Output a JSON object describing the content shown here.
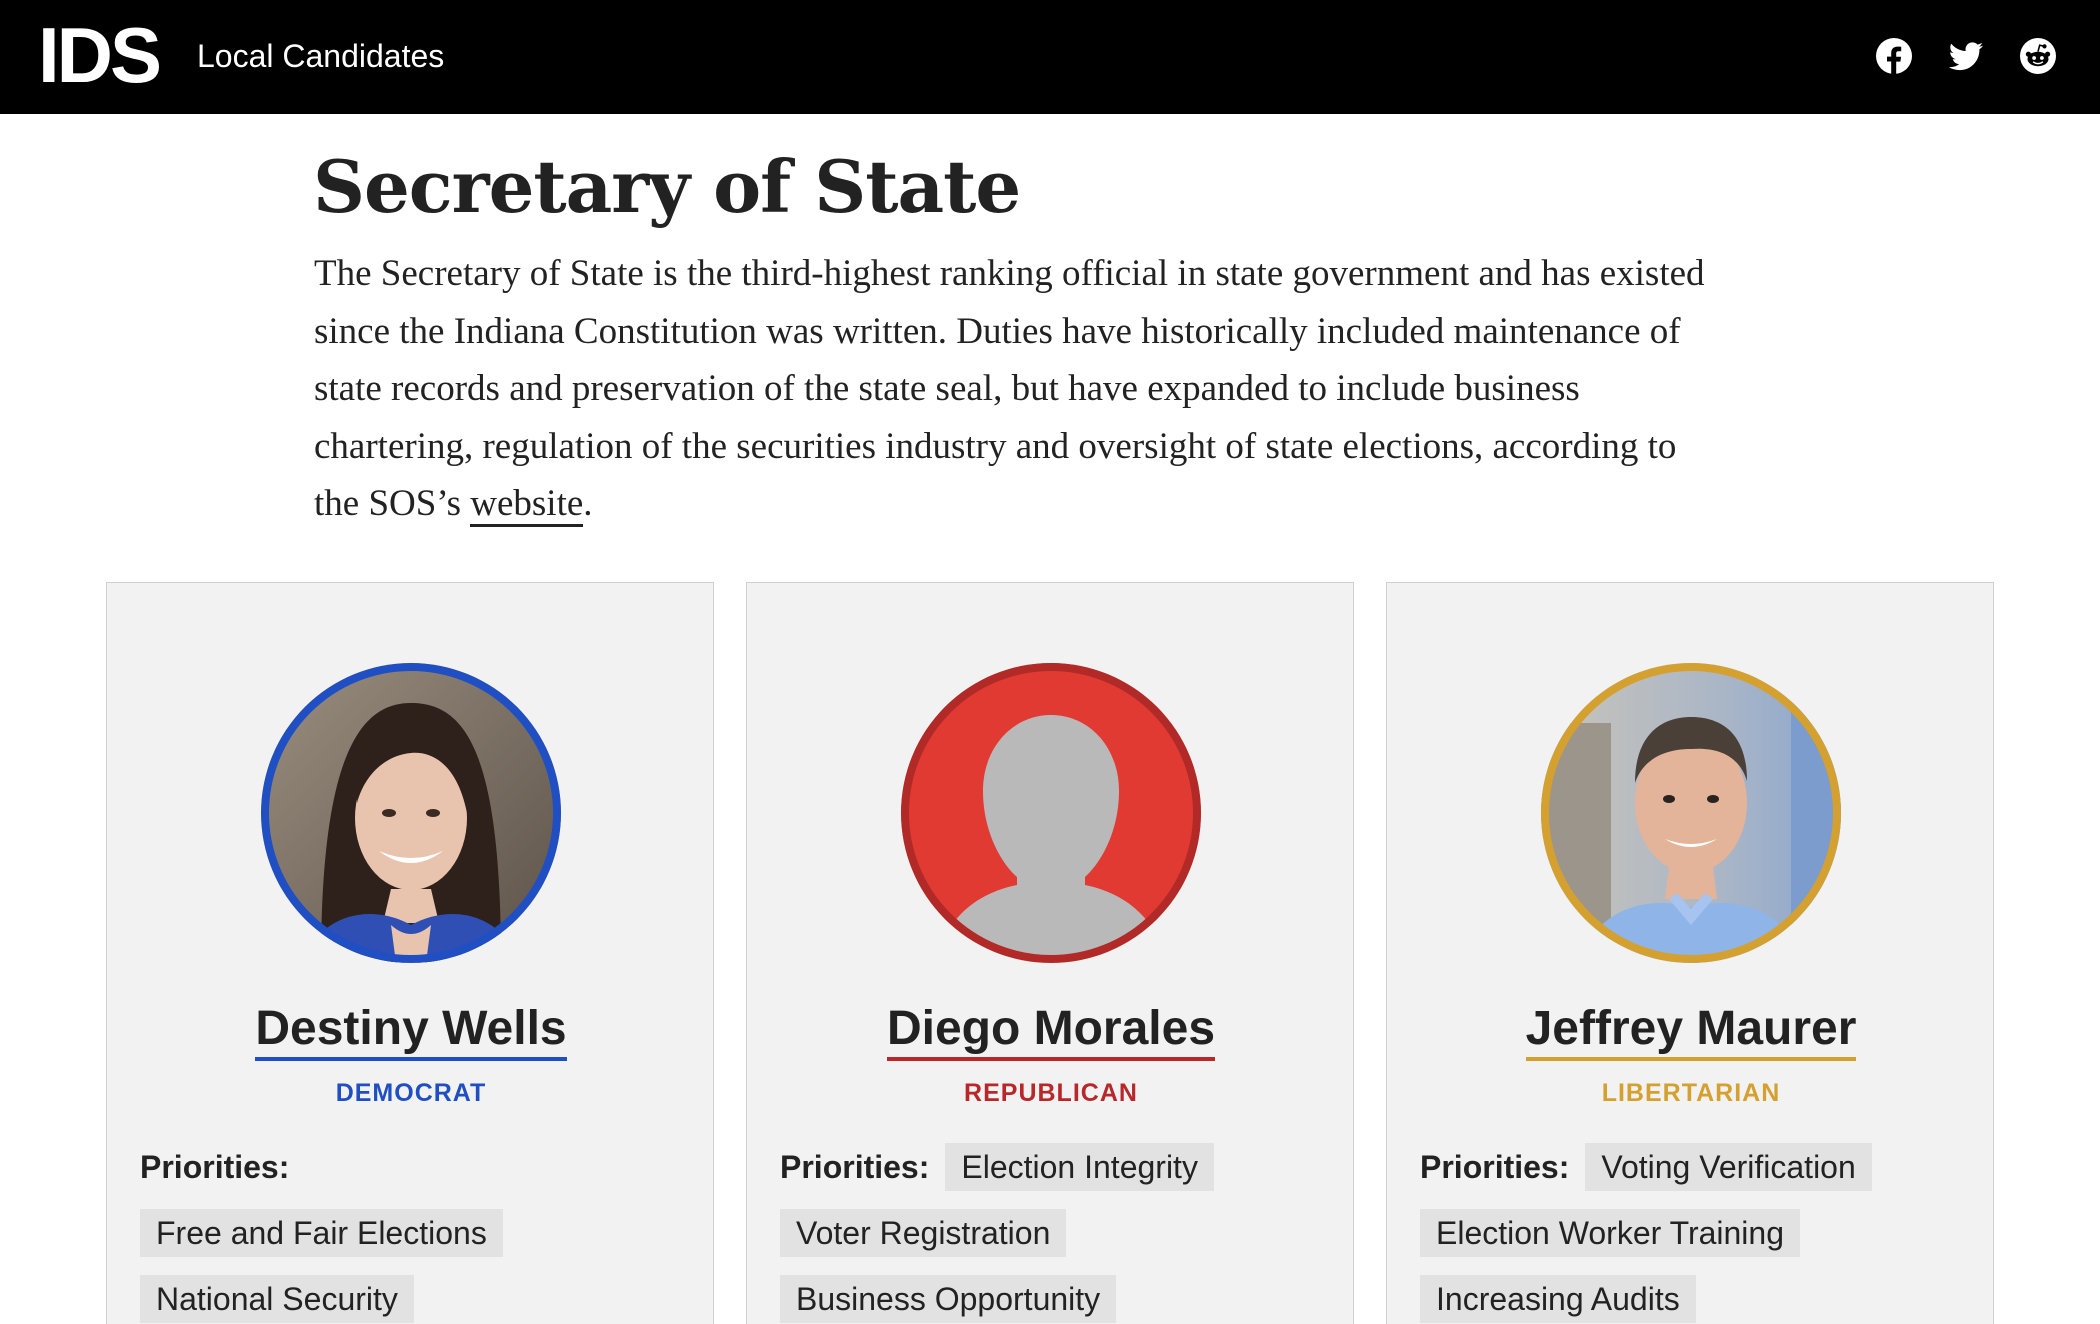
{
  "header": {
    "logo": "IDS",
    "title": "Local Candidates",
    "social": [
      "facebook-icon",
      "twitter-icon",
      "reddit-icon"
    ]
  },
  "section": {
    "title": "Secretary of State",
    "intro_text": "The Secretary of State is the third-highest ranking official in state government and has existed since the Indiana Constitution was written. Duties have historically included maintenance of state records and preservation of the state seal, but have expanded to include business chartering, regulation of the securities industry and oversight of state elections, according to the SOS’s ",
    "intro_link": "website",
    "intro_end": "."
  },
  "candidates": [
    {
      "name": "Destiny Wells",
      "party": "DEMOCRAT",
      "party_color": "#1f4fc2",
      "priorities_label": "Priorities:",
      "priorities": [
        "Free and Fair Elections",
        "National Security"
      ]
    },
    {
      "name": "Diego Morales",
      "party": "REPUBLICAN",
      "party_color": "#b8282b",
      "priorities_label": "Priorities:",
      "priorities": [
        "Election Integrity",
        "Voter Registration",
        "Business Opportunity"
      ]
    },
    {
      "name": "Jeffrey Maurer",
      "party": "LIBERTARIAN",
      "party_color": "#d4a030",
      "priorities_label": "Priorities:",
      "priorities": [
        "Voting Verification",
        "Election Worker Training",
        "Increasing Audits"
      ]
    }
  ]
}
